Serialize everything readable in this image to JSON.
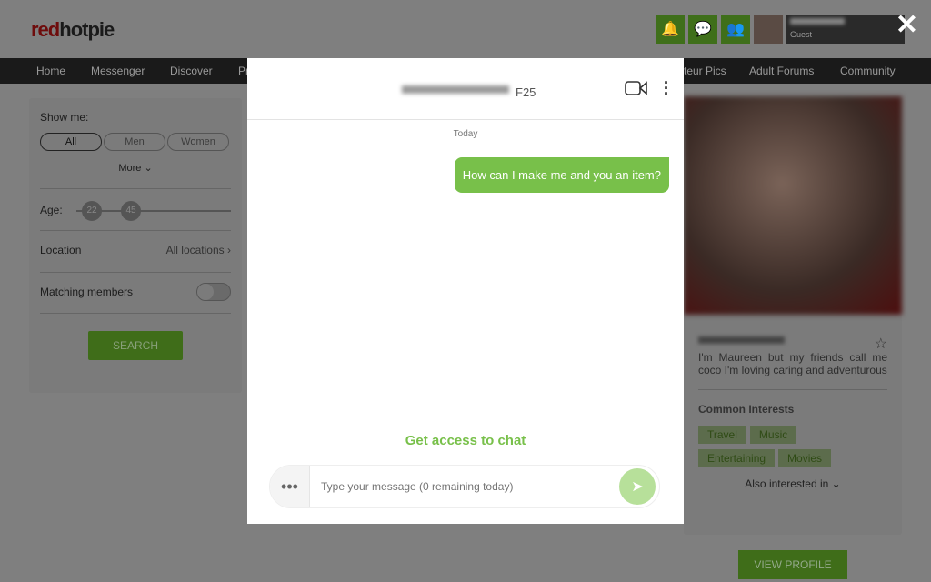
{
  "header": {
    "logo_red": "red",
    "logo_dark": "hotpie",
    "user_role": "Guest",
    "close": "✕"
  },
  "nav": [
    "Home",
    "Messenger",
    "Discover",
    "Pr",
    "teur Pics",
    "Adult Forums",
    "Community"
  ],
  "filter": {
    "show_me": "Show me:",
    "options": [
      "All",
      "Men",
      "Women"
    ],
    "more": "More ⌄",
    "age_label": "Age:",
    "age_min": "22",
    "age_max": "45",
    "location_label": "Location",
    "location_value": "All locations",
    "matching": "Matching members",
    "search": "SEARCH"
  },
  "profile": {
    "bio": "I'm Maureen but my friends call me coco I'm loving caring and adventurous",
    "common_interests": "Common Interests",
    "interests": [
      "Travel",
      "Music",
      "Entertaining",
      "Movies"
    ],
    "also": "Also interested in ⌄",
    "view_profile": "VIEW PROFILE"
  },
  "chat": {
    "age": "F25",
    "day": "Today",
    "message": "How can I make me and you an item?",
    "access": "Get access to chat",
    "placeholder": "Type your message (0 remaining today)"
  }
}
